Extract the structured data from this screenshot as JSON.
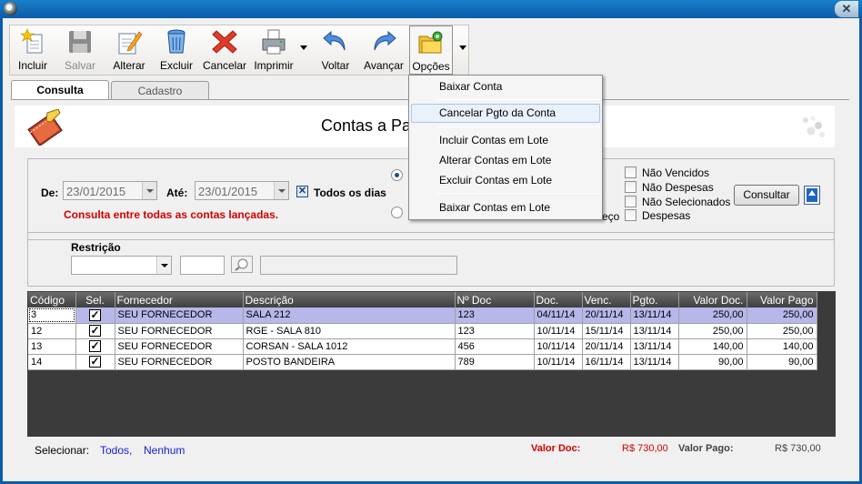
{
  "window": {
    "close_glyph": "✕"
  },
  "toolbar": {
    "buttons": [
      {
        "label": "Incluir",
        "icon": "new-document-star-icon",
        "enabled": true
      },
      {
        "label": "Salvar",
        "icon": "floppy-disk-icon",
        "enabled": false
      },
      {
        "label": "Alterar",
        "icon": "edit-pencil-icon",
        "enabled": true
      },
      {
        "label": "Excluir",
        "icon": "trash-can-icon",
        "enabled": true
      },
      {
        "label": "Cancelar",
        "icon": "red-x-icon",
        "enabled": true
      },
      {
        "label": "Imprimir",
        "icon": "printer-icon",
        "enabled": true
      },
      {
        "label": "Voltar",
        "icon": "back-arrow-icon",
        "enabled": true
      },
      {
        "label": "Avançar",
        "icon": "forward-arrow-icon",
        "enabled": true
      },
      {
        "label": "Opções",
        "icon": "folder-gear-icon",
        "enabled": true
      }
    ]
  },
  "tabs": [
    {
      "label": "Consulta",
      "active": true
    },
    {
      "label": "Cadastro",
      "active": false
    }
  ],
  "header": {
    "title_visible": "Contas a Pa"
  },
  "filter": {
    "de_label": "De:",
    "de_value": "23/01/2015",
    "ate_label": "Até:",
    "ate_value": "23/01/2015",
    "todos_os_dias_label": "Todos os dias",
    "todos_os_dias_checked": true,
    "status_text": "Consulta entre todas as contas lançadas.",
    "radio_hidden_fragment": "eço",
    "checkboxes": [
      {
        "label": "Não Vencidos",
        "checked": false
      },
      {
        "label": "Não Despesas",
        "checked": false
      },
      {
        "label": "Não Selecionados",
        "checked": false
      },
      {
        "label": "Despesas",
        "checked": false
      }
    ],
    "consultar_label": "Consultar"
  },
  "restricao": {
    "label": "Restrição"
  },
  "grid": {
    "columns": [
      "Código",
      "Sel.",
      "Fornecedor",
      "Descrição",
      "Nº Doc",
      "Doc.",
      "Venc.",
      "Pgto.",
      "Valor Doc.",
      "Valor Pago"
    ],
    "rows": [
      {
        "codigo": "3",
        "sel": "✓",
        "fornecedor": "SEU FORNECEDOR",
        "descricao": "SALA 212",
        "ndoc": "123",
        "doc": "04/11/14",
        "venc": "20/11/14",
        "pgto": "13/11/14",
        "valor_doc": "250,00",
        "valor_pago": "250,00",
        "selected": true
      },
      {
        "codigo": "12",
        "sel": "✓",
        "fornecedor": "SEU FORNECEDOR",
        "descricao": "RGE - SALA 810",
        "ndoc": "123",
        "doc": "10/11/14",
        "venc": "15/11/14",
        "pgto": "13/11/14",
        "valor_doc": "250,00",
        "valor_pago": "250,00",
        "selected": false
      },
      {
        "codigo": "13",
        "sel": "✓",
        "fornecedor": "SEU FORNECEDOR",
        "descricao": "CORSAN - SALA 1012",
        "ndoc": "456",
        "doc": "10/11/14",
        "venc": "20/11/14",
        "pgto": "13/11/14",
        "valor_doc": "140,00",
        "valor_pago": "140,00",
        "selected": false
      },
      {
        "codigo": "14",
        "sel": "✓",
        "fornecedor": "SEU FORNECEDOR",
        "descricao": "POSTO BANDEIRA",
        "ndoc": "789",
        "doc": "10/11/14",
        "venc": "16/11/14",
        "pgto": "13/11/14",
        "valor_doc": "90,00",
        "valor_pago": "90,00",
        "selected": false
      }
    ]
  },
  "footer": {
    "selecionar_label": "Selecionar:",
    "todos_link": "Todos,",
    "nenhum_link": "Nenhum",
    "valor_doc_label": "Valor Doc:",
    "valor_doc_total": "R$ 730,00",
    "valor_pago_label": "Valor Pago:",
    "valor_pago_total": "R$ 730,00"
  },
  "menu": {
    "items": [
      {
        "label": "Baixar Conta",
        "highlighted": false
      },
      {
        "label": "Cancelar Pgto da Conta",
        "highlighted": true
      },
      {
        "label": "Incluir Contas em Lote",
        "highlighted": false
      },
      {
        "label": "Alterar Contas em Lote",
        "highlighted": false
      },
      {
        "label": "Excluir Contas em Lote",
        "highlighted": false
      },
      {
        "label": "Baixar Contas em Lote",
        "highlighted": false
      }
    ]
  },
  "colors": {
    "title_bar": "#0a5ca8",
    "selected_row": "#b7b7ea",
    "status_red": "#d40000",
    "link_blue": "#1a1ad0"
  }
}
